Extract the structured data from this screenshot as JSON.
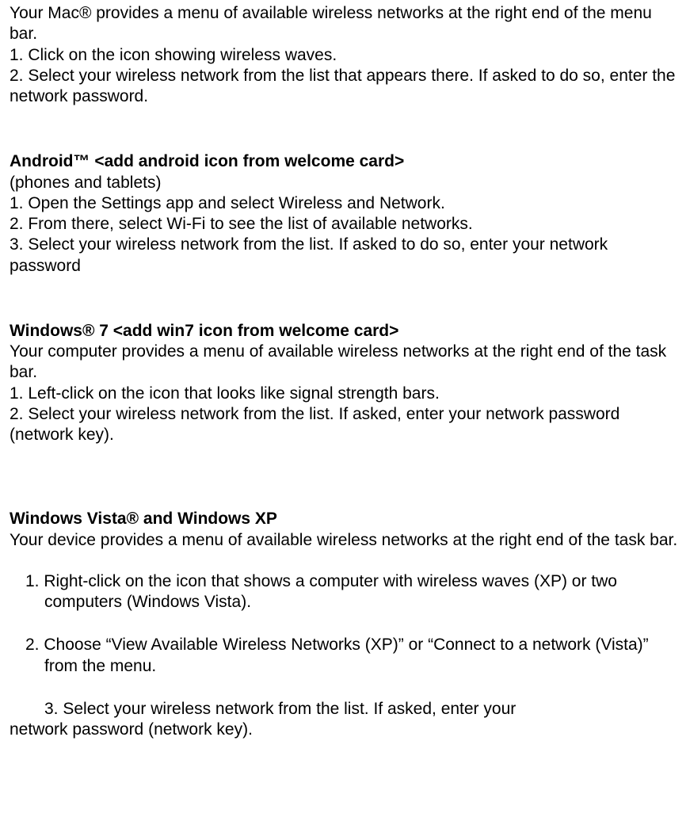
{
  "mac": {
    "intro": "Your Mac® provides a menu of available wireless networks at the right end of the menu bar.",
    "step1": "1. Click on the icon showing wireless waves.",
    "step2": "2. Select your wireless network from the list that appears there. If asked to do so, enter the network password."
  },
  "android": {
    "heading": "Android™ <add android icon from welcome card>",
    "subtitle": "(phones and tablets)",
    "step1": "1. Open the Settings app and select Wireless and Network.",
    "step2": "2. From there, select Wi-Fi to see the list of available networks.",
    "step3": "3. Select your wireless network from the list. If asked to do so, enter your network password"
  },
  "win7": {
    "heading": "Windows® 7 <add win7 icon from welcome card>",
    "intro": "Your computer provides a menu of available wireless networks at the right end of the task bar.",
    "step1": "1. Left-click on the icon that looks like signal strength bars.",
    "step2": "2. Select your wireless network from the list. If asked, enter your network password (network key)."
  },
  "vista": {
    "heading": "Windows Vista® and Windows XP",
    "intro": "Your device provides a menu of available wireless networks at the right end of the task bar.",
    "step1_num": "1.",
    "step1_text": "Right-click on the icon that shows a computer with wireless waves (XP) or two computers (Windows Vista).",
    "step2_num": "2.",
    "step2_text": "Choose “View Available Wireless Networks (XP)” or “Connect to a network (Vista)” from the menu.",
    "step3_line1": "3. Select your wireless network from the list. If asked, enter your",
    "step3_line2": "network password (network key)."
  }
}
